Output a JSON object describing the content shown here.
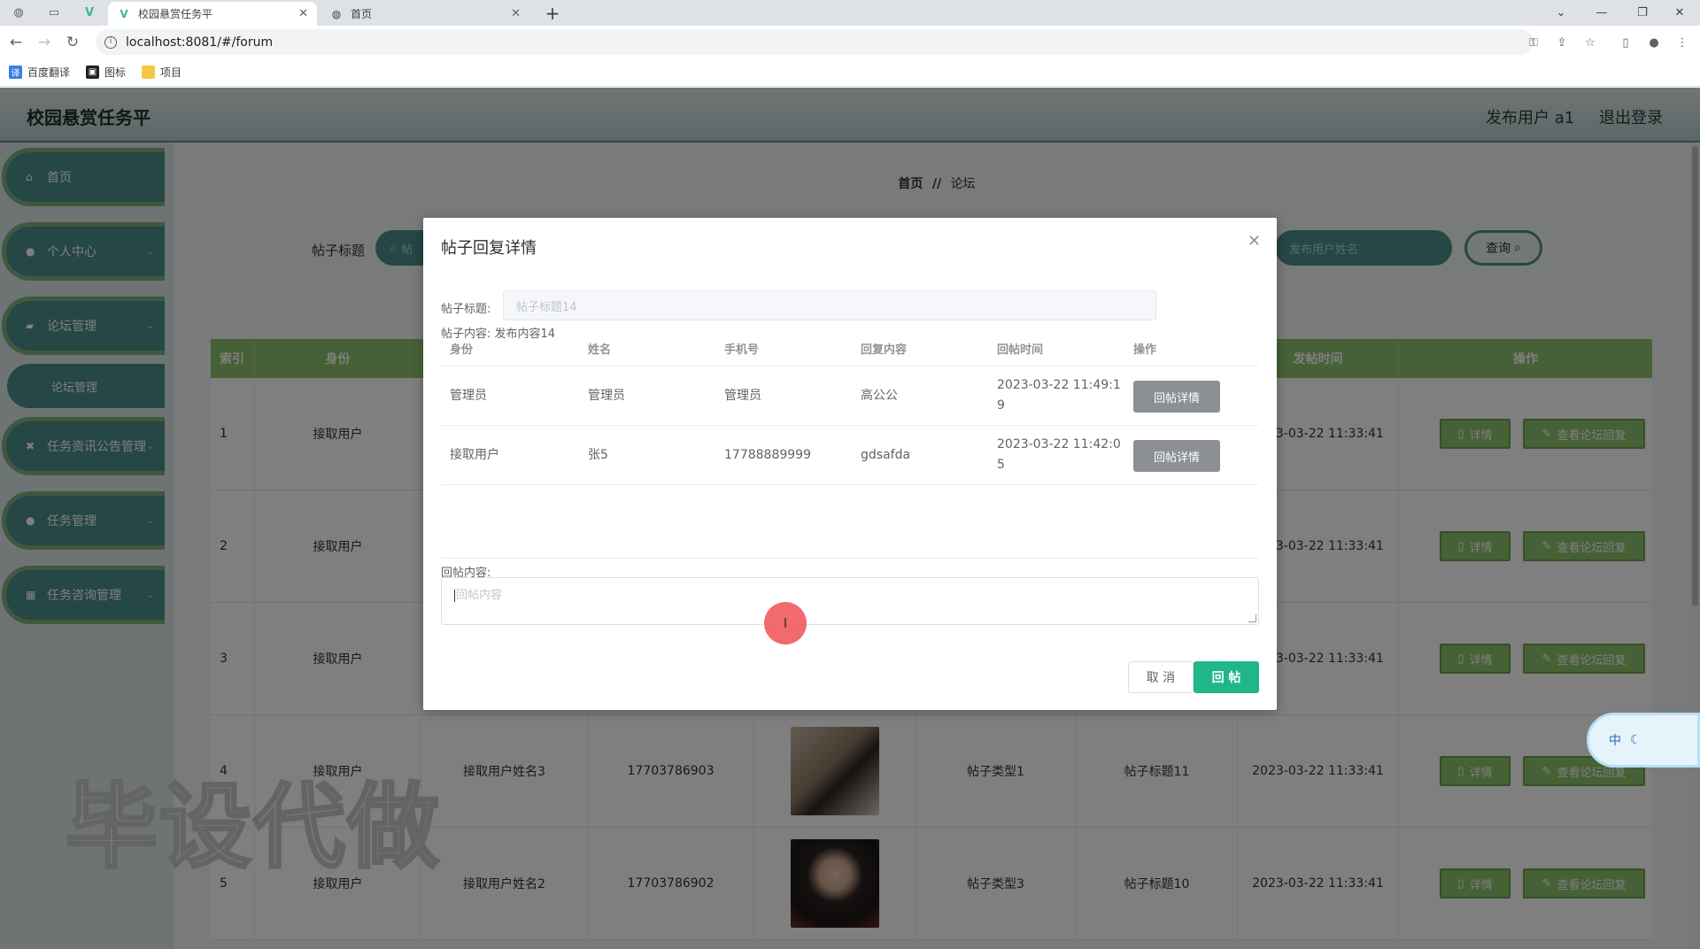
{
  "browser": {
    "tabs": [
      {
        "title": "校园悬赏任务平",
        "active": true
      },
      {
        "title": "首页",
        "active": false
      }
    ],
    "url": "localhost:8081/#/forum",
    "bookmarks": [
      "百度翻译",
      "图标",
      "项目"
    ]
  },
  "app": {
    "brand": "校园悬赏任务平",
    "user_label": "发布用户 a1",
    "logout": "退出登录",
    "accent": "#4a8f8b",
    "header_green": "#8cc26a"
  },
  "sidebar": {
    "items": [
      {
        "label": "首页",
        "icon": "home-icon"
      },
      {
        "label": "个人中心",
        "icon": "user-icon"
      },
      {
        "label": "论坛管理",
        "icon": "forum-icon"
      },
      {
        "label": "论坛管理",
        "icon": ""
      },
      {
        "label": "任务资讯公告管理",
        "icon": "notice-icon"
      },
      {
        "label": "任务管理",
        "icon": "task-icon"
      },
      {
        "label": "任务咨询管理",
        "icon": "grid-icon"
      }
    ]
  },
  "breadcrumb": {
    "home": "首页",
    "sep": "//",
    "current": "论坛"
  },
  "search": {
    "label": "帖子标题",
    "placeholder_left": "帖",
    "placeholder_right": "发布用户姓名",
    "query": "查询"
  },
  "table": {
    "headers": [
      "索引",
      "身份",
      "",
      "",
      "",
      "",
      "",
      "发帖时间",
      "操作"
    ],
    "rows": [
      {
        "index": "1",
        "role": "接取用户",
        "name": "",
        "phone": "",
        "type": "",
        "title": "",
        "time": "2023-03-22 11:33:41"
      },
      {
        "index": "2",
        "role": "接取用户",
        "name": "",
        "phone": "",
        "type": "",
        "title": "",
        "time": "2023-03-22 11:33:41"
      },
      {
        "index": "3",
        "role": "接取用户",
        "name": "",
        "phone": "",
        "type": "",
        "title": "",
        "time": "2023-03-22 11:33:41"
      },
      {
        "index": "4",
        "role": "接取用户",
        "name": "接取用户姓名3",
        "phone": "17703786903",
        "type": "帖子类型1",
        "title": "帖子标题11",
        "time": "2023-03-22 11:33:41"
      },
      {
        "index": "5",
        "role": "接取用户",
        "name": "接取用户姓名2",
        "phone": "17703786902",
        "type": "帖子类型3",
        "title": "帖子标题10",
        "time": "2023-03-22 11:33:41"
      }
    ],
    "detail_btn": "详情",
    "replies_btn": "查看论坛回复"
  },
  "modal": {
    "title": "帖子回复详情",
    "title_label": "帖子标题:",
    "title_value": "帖子标题14",
    "content_label": "帖子内容:",
    "content_value": "发布内容14",
    "columns": [
      "身份",
      "姓名",
      "手机号",
      "回复内容",
      "回帖时间",
      "操作"
    ],
    "rows": [
      {
        "role": "管理员",
        "name": "管理员",
        "phone": "管理员",
        "reply": "高公公",
        "time_a": "2023-03-22 11:49:1",
        "time_b": "9",
        "action": "回帖详情"
      },
      {
        "role": "接取用户",
        "name": "张5",
        "phone": "17788889999",
        "reply": "gdsafda",
        "time_a": "2023-03-22 11:42:0",
        "time_b": "5",
        "action": "回帖详情"
      }
    ],
    "reply_label": "回帖内容:",
    "reply_placeholder": "回帖内容",
    "cancel": "取 消",
    "submit": "回 帖"
  },
  "watermark": "毕设代做",
  "ime": "中"
}
